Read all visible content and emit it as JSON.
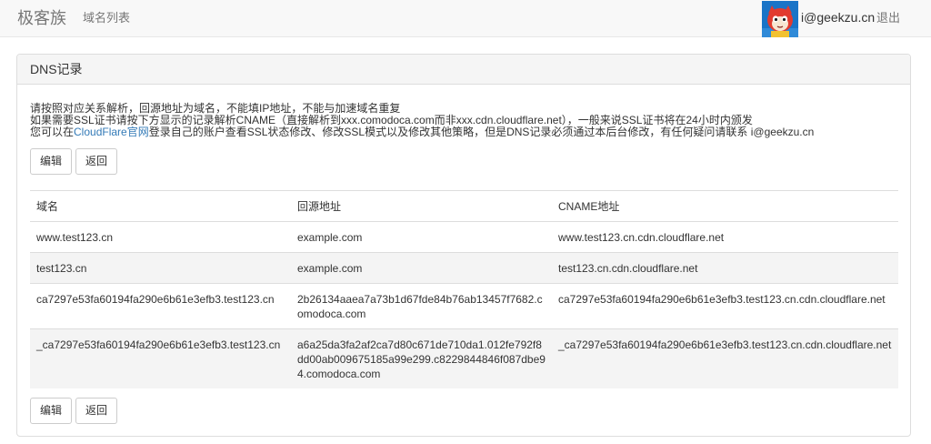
{
  "navbar": {
    "brand": "极客族",
    "nav_domains": "域名列表",
    "user_email": "i@geekzu.cn",
    "logout": "退出"
  },
  "panel": {
    "title": "DNS记录",
    "notes": {
      "line1": "请按照对应关系解析，回源地址为域名，不能填IP地址，不能与加速域名重复",
      "line2": "如果需要SSL证书请按下方显示的记录解析CNAME（直接解析到xxx.comodoca.com而非xxx.cdn.cloudflare.net），一般来说SSL证书将在24小时内颁发",
      "line3_prefix": "您可以在",
      "line3_link": "CloudFlare官网",
      "line3_suffix": "登录自己的账户查看SSL状态修改、修改SSL模式以及修改其他策略，但是DNS记录必须通过本后台修改，有任何疑问请联系 i@geekzu.cn"
    },
    "buttons_top": {
      "edit": "编辑",
      "back": "返回"
    },
    "buttons_bottom": {
      "edit": "编辑",
      "back": "返回"
    },
    "table": {
      "headers": [
        "域名",
        "回源地址",
        "CNAME地址"
      ],
      "rows": [
        [
          "www.test123.cn",
          "example.com",
          "www.test123.cn.cdn.cloudflare.net"
        ],
        [
          "test123.cn",
          "example.com",
          "test123.cn.cdn.cloudflare.net"
        ],
        [
          "ca7297e53fa60194fa290e6b61e3efb3.test123.cn",
          "2b26134aaea7a73b1d67fde84b76ab13457f7682.comodoca.com",
          "ca7297e53fa60194fa290e6b61e3efb3.test123.cn.cdn.cloudflare.net"
        ],
        [
          "_ca7297e53fa60194fa290e6b61e3efb3.test123.cn",
          "a6a25da3fa2af2ca7d80c671de710da1.012fe792f8dd00ab009675185a99e299.c8229844846f087dbe94.comodoca.com",
          "_ca7297e53fa60194fa290e6b61e3efb3.test123.cn.cdn.cloudflare.net"
        ]
      ]
    }
  },
  "colors": {
    "navbar_bg": "#f8f8f8",
    "link": "#337ab7",
    "avatar_bg": "#1a74c7",
    "avatar_face": "#e23b2f"
  }
}
